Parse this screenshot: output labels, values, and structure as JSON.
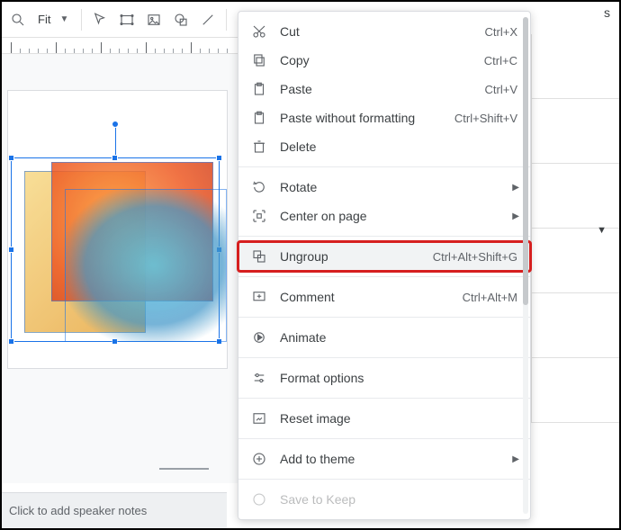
{
  "toolbar": {
    "zoom_label": "Fit"
  },
  "menu": {
    "cut": {
      "label": "Cut",
      "shortcut": "Ctrl+X"
    },
    "copy": {
      "label": "Copy",
      "shortcut": "Ctrl+C"
    },
    "paste": {
      "label": "Paste",
      "shortcut": "Ctrl+V"
    },
    "paste_no_fmt": {
      "label": "Paste without formatting",
      "shortcut": "Ctrl+Shift+V"
    },
    "delete": {
      "label": "Delete",
      "shortcut": ""
    },
    "rotate": {
      "label": "Rotate",
      "shortcut": ""
    },
    "center": {
      "label": "Center on page",
      "shortcut": ""
    },
    "ungroup": {
      "label": "Ungroup",
      "shortcut": "Ctrl+Alt+Shift+G"
    },
    "comment": {
      "label": "Comment",
      "shortcut": "Ctrl+Alt+M"
    },
    "animate": {
      "label": "Animate",
      "shortcut": ""
    },
    "format_options": {
      "label": "Format options",
      "shortcut": ""
    },
    "reset_image": {
      "label": "Reset image",
      "shortcut": ""
    },
    "add_to_theme": {
      "label": "Add to theme",
      "shortcut": ""
    },
    "save_to_keep": {
      "label": "Save to Keep",
      "shortcut": ""
    }
  },
  "notes_placeholder": "Click to add speaker notes",
  "rail_top": "s"
}
